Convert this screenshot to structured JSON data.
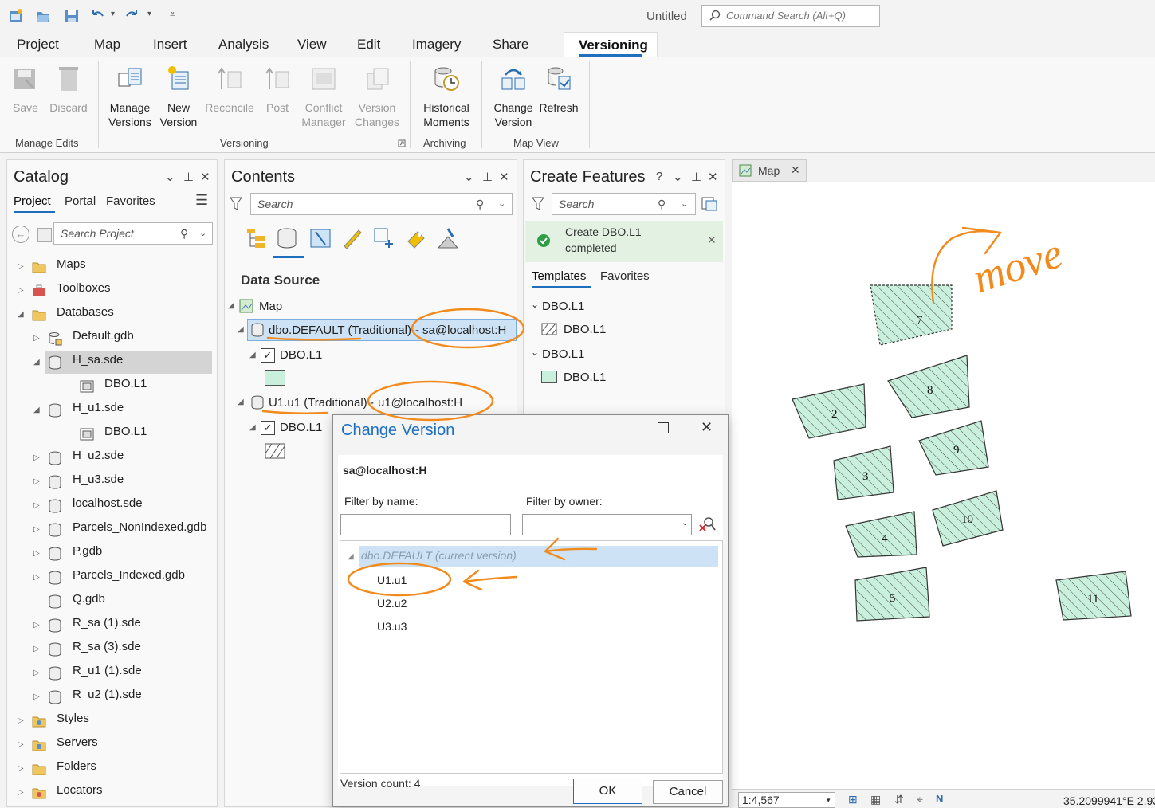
{
  "window": {
    "title": "Untitled",
    "command_search_placeholder": "Command Search (Alt+Q)"
  },
  "ribbon": {
    "tabs": [
      "Project",
      "Map",
      "Insert",
      "Analysis",
      "View",
      "Edit",
      "Imagery",
      "Share"
    ],
    "active_tab": "Versioning",
    "buttons": {
      "save": "Save",
      "discard": "Discard",
      "manage_versions_1": "Manage",
      "manage_versions_2": "Versions",
      "new_version_1": "New",
      "new_version_2": "Version",
      "reconcile": "Reconcile",
      "post": "Post",
      "conflict_1": "Conflict",
      "conflict_2": "Manager",
      "vchanges_1": "Version",
      "vchanges_2": "Changes",
      "historical_1": "Historical",
      "historical_2": "Moments",
      "change_version_1": "Change",
      "change_version_2": "Version",
      "refresh": "Refresh"
    },
    "groups": {
      "manage_edits": "Manage Edits",
      "versioning": "Versioning",
      "archiving": "Archiving",
      "map_view": "Map View"
    }
  },
  "catalog": {
    "title": "Catalog",
    "tabs": [
      "Project",
      "Portal",
      "Favorites"
    ],
    "search_placeholder": "Search Project",
    "items": [
      "Maps",
      "Toolboxes",
      "Databases",
      "Default.gdb",
      "H_sa.sde",
      "DBO.L1",
      "H_u1.sde",
      "DBO.L1",
      "H_u2.sde",
      "H_u3.sde",
      "localhost.sde",
      "Parcels_NonIndexed.gdb",
      "P.gdb",
      "Parcels_Indexed.gdb",
      "Q.gdb",
      "R_sa (1).sde",
      "R_sa (3).sde",
      "R_u1 (1).sde",
      "R_u2 (1).sde",
      "Styles",
      "Servers",
      "Folders",
      "Locators"
    ]
  },
  "contents": {
    "title": "Contents",
    "search_placeholder": "Search",
    "section": "Data Source",
    "map": "Map",
    "src1_name": "dbo.DEFAULT (Traditional)",
    "src1_conn": "sa@localhost:H",
    "layer1": "DBO.L1",
    "src2_name": "U1.u1 (Traditional)",
    "src2_conn": "u1@localhost:H",
    "layer2": "DBO.L1"
  },
  "create_features": {
    "title": "Create Features",
    "search_placeholder": "Search",
    "message_1": "Create DBO.L1",
    "message_2": "completed",
    "tabs": [
      "Templates",
      "Favorites"
    ],
    "groups": [
      {
        "name": "DBO.L1",
        "template": "DBO.L1"
      },
      {
        "name": "DBO.L1",
        "template": "DBO.L1"
      }
    ]
  },
  "map": {
    "tab": "Map",
    "annotation": "move",
    "parcels": [
      "7",
      "8",
      "2",
      "9",
      "3",
      "10",
      "4",
      "5",
      "11"
    ],
    "scale": "1:4,567",
    "coords": "35.2099941°E 2.93"
  },
  "dialog": {
    "title": "Change Version",
    "connection": "sa@localhost:H",
    "filter_name_label": "Filter by name:",
    "filter_owner_label": "Filter by owner:",
    "filter_name_value": "",
    "filter_owner_value": "",
    "versions": [
      "dbo.DEFAULT (current version)",
      "U1.u1",
      "U2.u2",
      "U3.u3"
    ],
    "version_count": "Version count: 4",
    "ok": "OK",
    "cancel": "Cancel"
  }
}
